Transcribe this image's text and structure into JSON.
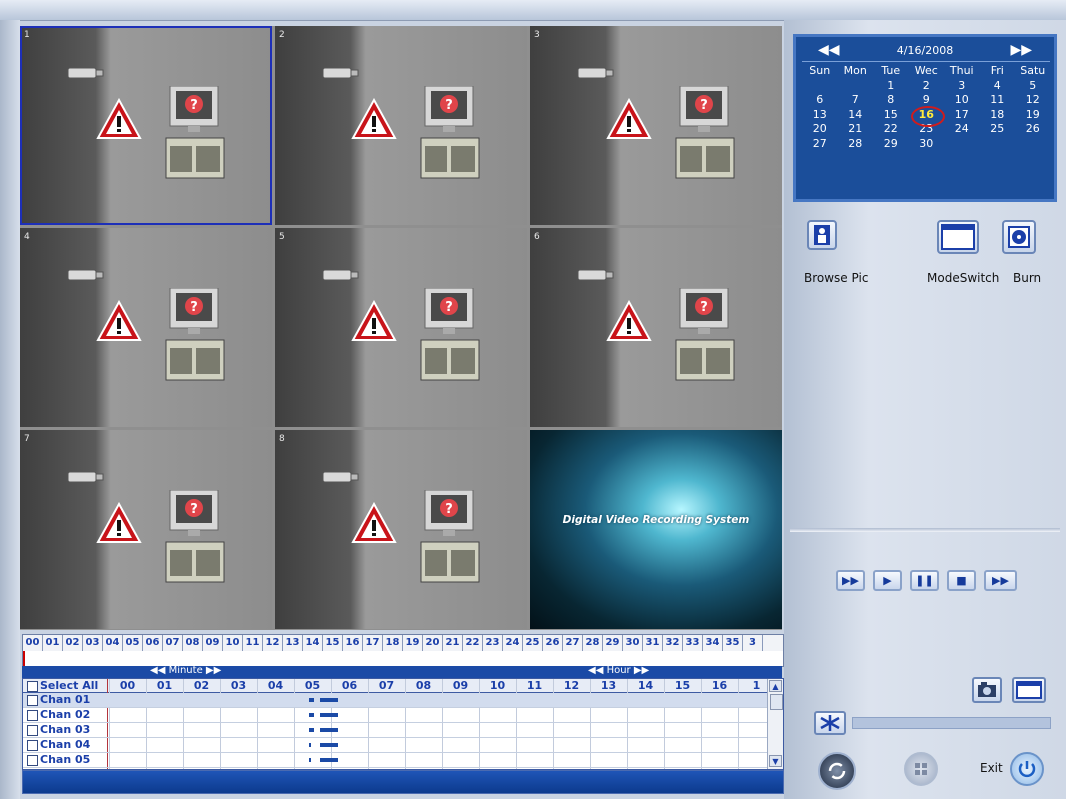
{
  "channels": [
    {
      "num": "1"
    },
    {
      "num": "2"
    },
    {
      "num": "3"
    },
    {
      "num": "4"
    },
    {
      "num": "5"
    },
    {
      "num": "6"
    },
    {
      "num": "7"
    },
    {
      "num": "8"
    }
  ],
  "splash": {
    "text": "Digital Video Recording System"
  },
  "timeline": {
    "hours": [
      "00",
      "01",
      "02",
      "03",
      "04",
      "05",
      "06",
      "07",
      "08",
      "09",
      "10",
      "11",
      "12",
      "13",
      "14",
      "15",
      "16",
      "17",
      "18",
      "19",
      "20",
      "21",
      "22",
      "23",
      "24",
      "25",
      "26",
      "27",
      "28",
      "29",
      "30",
      "31",
      "32",
      "33",
      "34",
      "35",
      "3"
    ],
    "minute_label": "Minute",
    "hour_label": "Hour"
  },
  "table": {
    "select_all": "Select All",
    "columns": [
      "00",
      "01",
      "02",
      "03",
      "04",
      "05",
      "06",
      "07",
      "08",
      "09",
      "10",
      "11",
      "12",
      "13",
      "14",
      "15",
      "16",
      "1"
    ],
    "rows": [
      "Chan 01",
      "Chan 02",
      "Chan 03",
      "Chan 04",
      "Chan 05"
    ]
  },
  "calendar": {
    "title": "4/16/2008",
    "prev": "◀◀",
    "next": "▶▶",
    "weekdays": [
      "Sun",
      "Mon",
      "Tue",
      "Wec",
      "Thui",
      "Fri",
      "Satu"
    ],
    "days": [
      "",
      "",
      "1",
      "2",
      "3",
      "4",
      "5",
      "6",
      "7",
      "8",
      "9",
      "10",
      "11",
      "12",
      "13",
      "14",
      "15",
      "16",
      "17",
      "18",
      "19",
      "20",
      "21",
      "22",
      "23",
      "24",
      "25",
      "26",
      "27",
      "28",
      "29",
      "30",
      "",
      "",
      ""
    ],
    "selected": "16"
  },
  "tools": {
    "browse": "Browse Pic",
    "mode": "ModeSwitch",
    "burn": "Burn"
  },
  "playback": {
    "exit_label": "Exit"
  },
  "colors": {
    "accent": "#1b4aa6",
    "calendar_bg": "#1b4e9a",
    "selected_outline": "#1d2fb8"
  }
}
